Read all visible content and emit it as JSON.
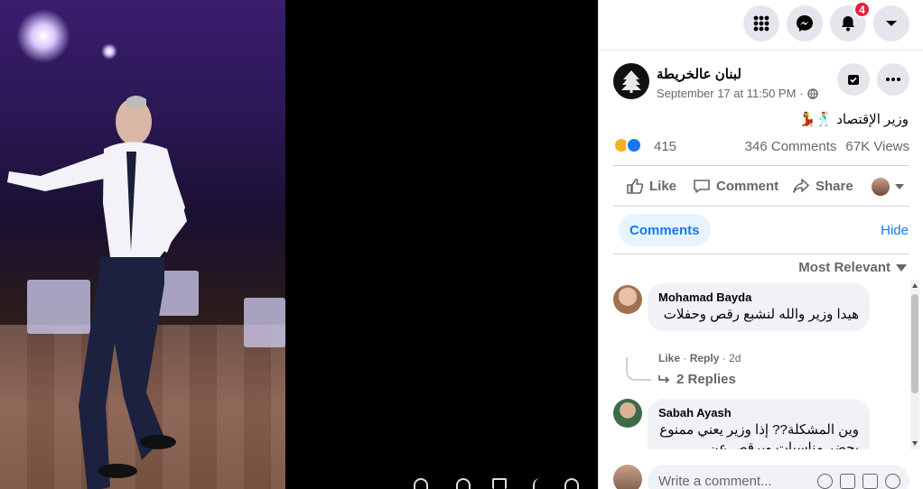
{
  "topbar": {
    "notifications_count": "4",
    "icons": [
      "menu-grid-icon",
      "messenger-icon",
      "bell-icon",
      "caret-down-icon"
    ]
  },
  "post": {
    "page_name": "لبنان عالخريطة",
    "date": "September 17 at 11:50 PM",
    "privacy": "·",
    "text": "وزير الإقتصاد 🕺💃",
    "reaction_count": "415",
    "comments_count": "346 Comments",
    "views_count": "67K Views"
  },
  "actions": {
    "like": "Like",
    "comment": "Comment",
    "share": "Share"
  },
  "comments_section": {
    "tab_label": "Comments",
    "hide_label": "Hide",
    "sort_label": "Most Relevant",
    "items": [
      {
        "name": "Mohamad Bayda",
        "text": "هيدا وزير والله لنشبع رقص وحفلات",
        "like": "Like",
        "reply": "Reply",
        "time": "2d",
        "replies": "2 Replies"
      },
      {
        "name": "Sabah Ayash",
        "text": "وين المشكلة?? إذا وزير يعني ممنوع يحضر مناسبات ويرقص عن"
      }
    ]
  },
  "composer": {
    "placeholder": "Write a comment..."
  },
  "colors": {
    "accent": "#1877f2",
    "badge": "#e41e3f",
    "secondary_text": "#65676b"
  }
}
